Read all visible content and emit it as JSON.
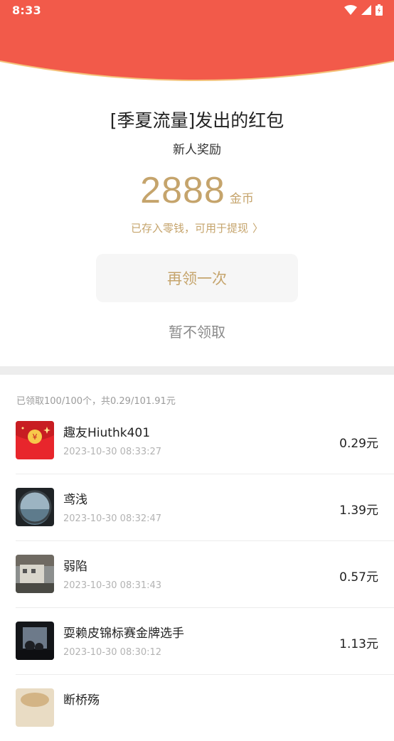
{
  "status_bar": {
    "time": "8:33",
    "icons": [
      "wifi-icon",
      "signal-icon",
      "battery-icon"
    ]
  },
  "colors": {
    "header_red": "#f25a4a",
    "gold": "#c5a46c",
    "arc_line": "#f4c27a"
  },
  "envelope": {
    "title": "[季夏流量]发出的红包",
    "subtitle": "新人奖励",
    "amount": "2888",
    "unit": "金币",
    "stored_text": "已存入零钱，可用于提现",
    "chevron": "〉",
    "again_label": "再领一次",
    "skip_label": "暂不领取"
  },
  "records": {
    "summary": "已领取100/100个，共0.29/101.91元",
    "items": [
      {
        "name": "趣友Hiuthk401",
        "time": "2023-10-30 08:33:27",
        "amount": "0.29元",
        "avatar": "red-envelope-avatar"
      },
      {
        "name": "鸢浅",
        "time": "2023-10-30 08:32:47",
        "amount": "1.39元",
        "avatar": "sea-window-avatar"
      },
      {
        "name": "弱陷",
        "time": "2023-10-30 08:31:43",
        "amount": "0.57元",
        "avatar": "building-photo-avatar"
      },
      {
        "name": "耍赖皮锦标赛金牌选手",
        "time": "2023-10-30 08:30:12",
        "amount": "1.13元",
        "avatar": "dark-figures-avatar"
      },
      {
        "name": "断桥殇",
        "time": "",
        "amount": "",
        "avatar": "food-photo-avatar"
      }
    ]
  }
}
